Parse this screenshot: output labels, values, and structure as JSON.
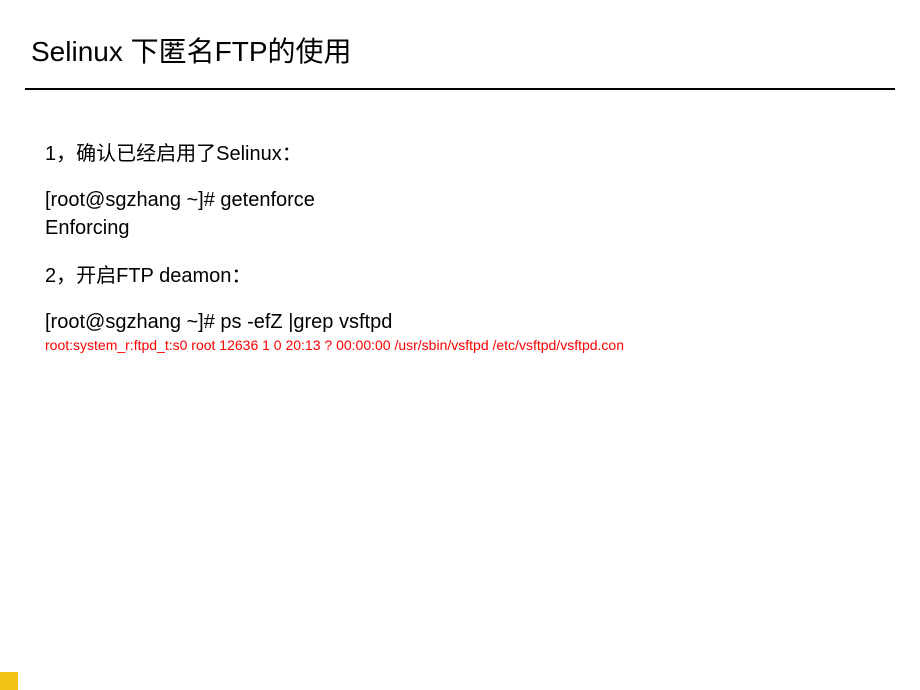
{
  "title": "Selinux 下匿名FTP的使用",
  "step1_label": "1，确认已经启用了Selinux：",
  "step1_cmd": "[root@sgzhang ~]# getenforce",
  "step1_output": "Enforcing",
  "step2_label": "2，开启FTP deamon：",
  "step2_cmd": "[root@sgzhang ~]# ps  -efZ |grep vsftpd",
  "step2_output": "root:system_r:ftpd_t:s0        root     12636     1  0 20:13 ?        00:00:00 /usr/sbin/vsftpd /etc/vsftpd/vsftpd.con"
}
